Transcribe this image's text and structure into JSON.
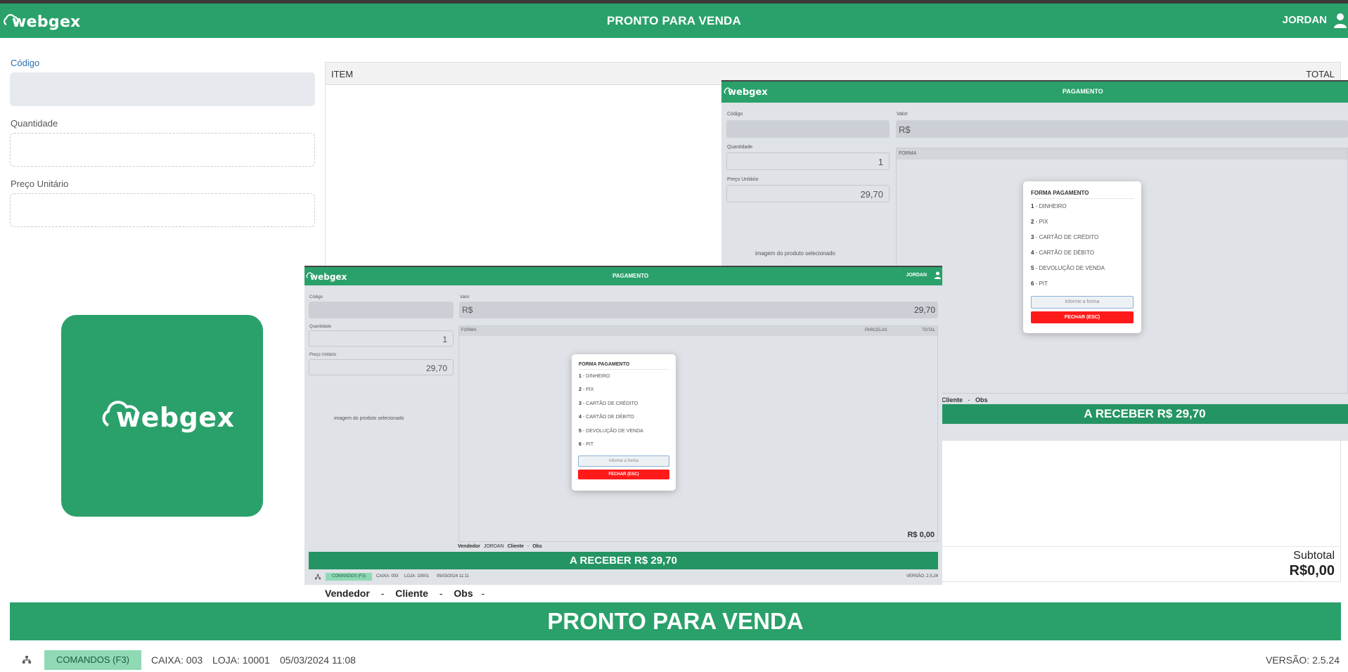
{
  "header": {
    "logo_text": "webgex",
    "title": "PRONTO PARA VENDA",
    "user": "JORDAN",
    "user_icon": "user-icon"
  },
  "form": {
    "codigo_label": "Código",
    "quantidade_label": "Quantidade",
    "preco_label": "Preço Unitário"
  },
  "big_logo_text": "webgex",
  "items_table": {
    "col_item": "ITEM",
    "col_total": "TOTAL"
  },
  "subtotal": {
    "label": "Subtotal",
    "value": "R$0,00"
  },
  "meta": {
    "vendedor_label": "Vendedor",
    "cliente_label": "Cliente",
    "obs_label": "Obs",
    "sep": "-"
  },
  "status_banner": "PRONTO PARA VENDA",
  "footer": {
    "network_icon": "network-icon",
    "commands_button": "COMANDOS (F3)",
    "caixa": "CAIXA: 003",
    "loja": "LOJA: 10001",
    "datetime": "05/03/2024 11:08",
    "version": "VERSÃO: 2.5.24"
  },
  "payment_back": {
    "logo_text": "webgex",
    "title": "PAGAMENTO",
    "codigo_label": "Código",
    "valor_label": "Valor",
    "valor_prefix": "R$",
    "quantidade_label": "Quantidade",
    "quantidade_value": "1",
    "preco_label": "Preço Unitário",
    "preco_value": "29,70",
    "forma_header": "FORMA",
    "image_alt": "imagem do produto selecionado",
    "meta_cliente": "Cliente",
    "meta_sep": "-",
    "meta_obs": "Obs",
    "receber": "A RECEBER R$ 29,70",
    "modal": {
      "title": "FORMA PAGAMENTO",
      "items": [
        {
          "num": "1",
          "label": "DINHEIRO"
        },
        {
          "num": "2",
          "label": "PIX"
        },
        {
          "num": "3",
          "label": "CARTÃO DE CRÉDITO"
        },
        {
          "num": "4",
          "label": "CARTÃO DE DÉBITO"
        },
        {
          "num": "5",
          "label": "DEVOLUÇÃO DE VENDA"
        },
        {
          "num": "6",
          "label": "PIT"
        }
      ],
      "placeholder": "informe a forma",
      "close": "FECHAR (ESC)"
    }
  },
  "payment_front": {
    "logo_text": "webgex",
    "title": "PAGAMENTO",
    "user": "JORDAN",
    "codigo_label": "Código",
    "valor_label": "Valor",
    "valor_prefix": "R$",
    "valor_value": "29,70",
    "quantidade_label": "Quantidade",
    "quantidade_value": "1",
    "preco_label": "Preço Unitário",
    "preco_value": "29,70",
    "col_forma": "FORMA",
    "col_parcelas": "PARCELAS",
    "col_total": "TOTAL",
    "image_alt": "imagem do produto selecionado",
    "total_value": "R$ 0,00",
    "meta_vendedor": "Vendedor",
    "meta_vendedor_value": "JORDAN",
    "meta_cliente": "Cliente",
    "meta_sep": "-",
    "meta_obs": "Obs",
    "receber": "A RECEBER R$ 29,70",
    "commands_button": "COMANDOS (F3)",
    "caixa": "CAIXA: 003",
    "loja": "LOJA: 10001",
    "datetime": "05/03/2024 11:11",
    "version": "VERSÃO: 2.5.24",
    "modal": {
      "title": "FORMA PAGAMENTO",
      "items": [
        {
          "num": "1",
          "label": "DINHEIRO"
        },
        {
          "num": "2",
          "label": "PIX"
        },
        {
          "num": "3",
          "label": "CARTÃO DE CRÉDITO"
        },
        {
          "num": "4",
          "label": "CARTÃO DE DÉBITO"
        },
        {
          "num": "5",
          "label": "DEVOLUÇÃO DE VENDA"
        },
        {
          "num": "6",
          "label": "PIT"
        }
      ],
      "placeholder": "informe a forma",
      "close": "FECHAR (ESC)"
    }
  },
  "colors": {
    "brand_green": "#2aa16a",
    "danger_red": "#ff1a1a",
    "command_button_bg": "#8fd9b5"
  }
}
